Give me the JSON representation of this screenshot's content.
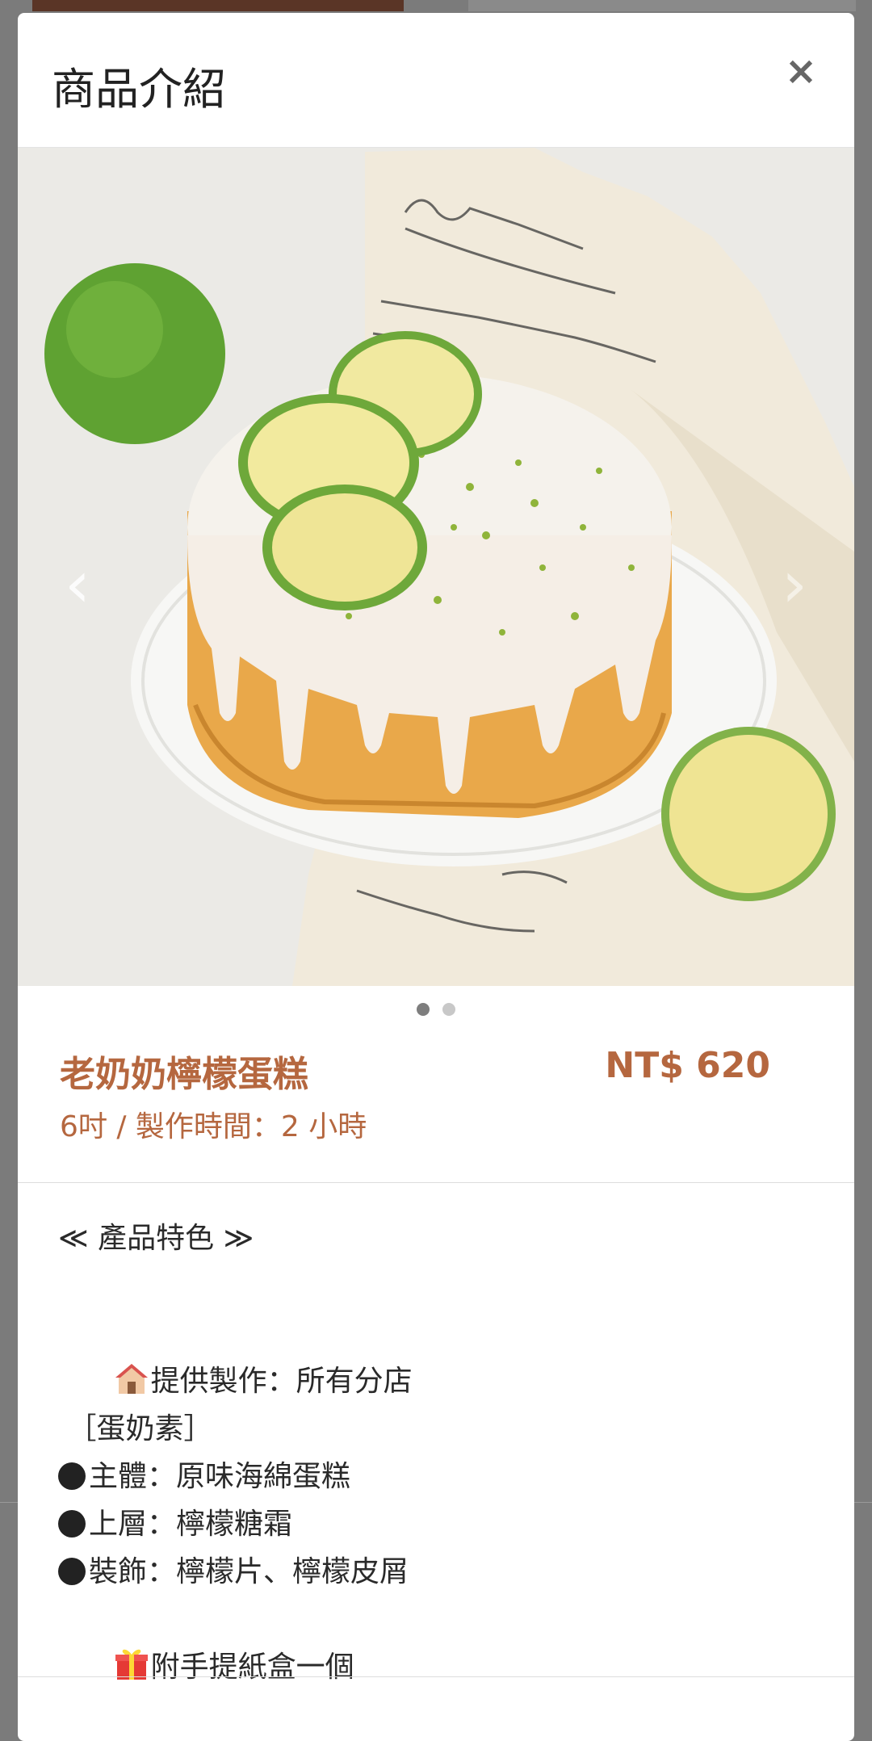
{
  "modal": {
    "title": "商品介紹",
    "close_label": "×"
  },
  "carousel": {
    "prev_label": "‹",
    "next_label": "›",
    "dot_count": 2,
    "active_index": 0
  },
  "product": {
    "name": "老奶奶檸檬蛋糕",
    "price": "NT$ 620",
    "meta": "6吋 / 製作時間：2 小時"
  },
  "description": {
    "heading": "≪ 產品特色 ≫",
    "location": "提供製作：所有分店",
    "diet": " ［蛋奶素］",
    "items": [
      "主體：原味海綿蛋糕",
      "上層：檸檬糖霜",
      "裝飾：檸檬片、檸檬皮屑"
    ],
    "gift": "附手提紙盒一個"
  },
  "colors": {
    "accent": "#b5673f",
    "overlay": "#7b7b7b"
  }
}
